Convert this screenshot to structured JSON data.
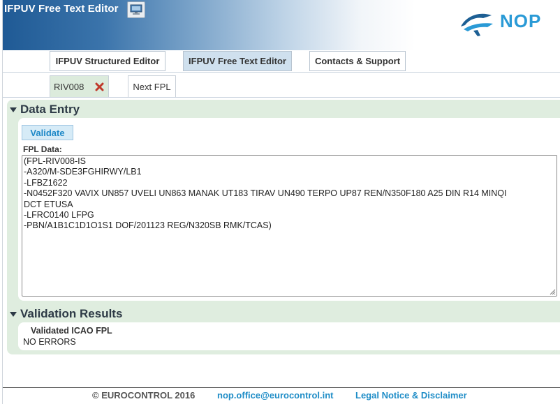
{
  "header": {
    "title": "IFPUV Free Text Editor",
    "monitor_icon": "monitor-icon",
    "logo_text": "NOP",
    "brand_color": "#2a9ad6"
  },
  "top_tabs": [
    {
      "label": "IFPUV Structured Editor",
      "active": false
    },
    {
      "label": "IFPUV Free Text Editor",
      "active": true
    },
    {
      "label": "Contacts & Support",
      "active": false
    }
  ],
  "sub_tabs": {
    "fpl_tab": {
      "label": "RIV008",
      "close_icon": "close-icon"
    },
    "next_tab": {
      "label": "Next FPL"
    }
  },
  "data_entry": {
    "title": "Data Entry",
    "validate_label": "Validate",
    "fpl_label": "FPL Data:",
    "fpl_lines": [
      "(FPL-RIV008-IS",
      "-A320/M-SDE3FGHIRWY/LB1",
      "-LFBZ1622",
      "-N0452F320 VAVIX UN857 UVELI UN863 MANAK UT183 TIRAV UN490 TERPO UP87 REN/N350F180 A25 DIN R14 MINQI",
      "DCT ETUSA",
      "-LFRC0140 LFPG",
      "-PBN/A1B1C1D1O1S1 DOF/201123 REG/N320SB RMK/TCAS)"
    ]
  },
  "validation_results": {
    "title": "Validation Results",
    "label": "Validated ICAO FPL",
    "value": "NO ERRORS"
  },
  "footer": {
    "copyright": "© EUROCONTROL 2016",
    "email": "nop.office@eurocontrol.int",
    "legal": "Legal Notice & Disclaimer"
  }
}
